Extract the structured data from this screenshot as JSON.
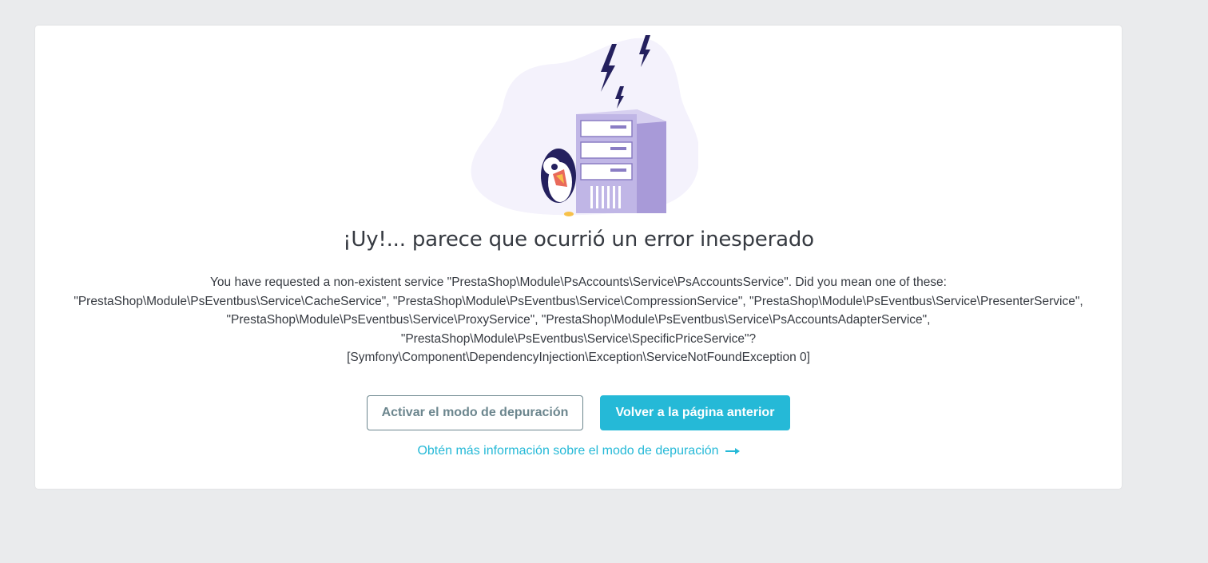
{
  "error_page": {
    "title": "¡Uy!... parece que ocurrió un error inesperado",
    "message": "You have requested a non-existent service \"PrestaShop\\Module\\PsAccounts\\Service\\PsAccountsService\". Did you mean one of these:\n\"PrestaShop\\Module\\PsEventbus\\Service\\CacheService\", \"PrestaShop\\Module\\PsEventbus\\Service\\CompressionService\", \"PrestaShop\\Module\\PsEventbus\\Service\\PresenterService\",\n\"PrestaShop\\Module\\PsEventbus\\Service\\ProxyService\", \"PrestaShop\\Module\\PsEventbus\\Service\\PsAccountsAdapterService\",\n\"PrestaShop\\Module\\PsEventbus\\Service\\SpecificPriceService\"?\n[Symfony\\Component\\DependencyInjection\\Exception\\ServiceNotFoundException 0]",
    "debug_button_label": "Activar el modo de depuración",
    "back_button_label": "Volver a la página anterior",
    "more_info_link": "Obtén más información sobre el modo de depuración",
    "illustration_icon": "server-error-illustration",
    "link_arrow_icon": "arrow-right-icon"
  },
  "colors": {
    "primary": "#25b9d7",
    "outline": "#6c868e",
    "text": "#363a41",
    "background": "#eaebed",
    "illustration_server": "#c0b6e6",
    "illustration_blob": "#f4f2fc",
    "illustration_bolt": "#24205e"
  }
}
